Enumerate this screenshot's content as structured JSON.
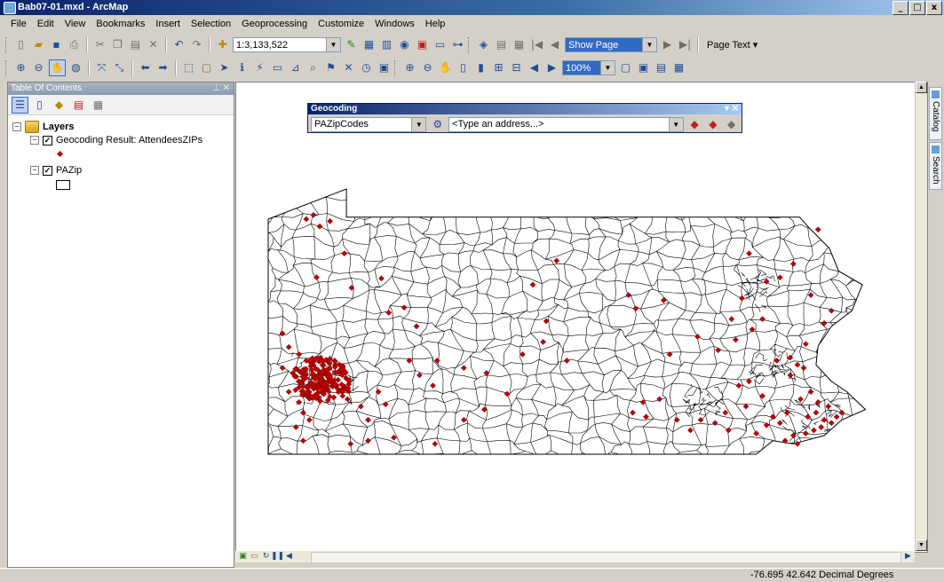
{
  "window": {
    "title": "Bab07-01.mxd - ArcMap",
    "controls": [
      "_",
      "□",
      "x"
    ]
  },
  "menu": [
    "File",
    "Edit",
    "View",
    "Bookmarks",
    "Insert",
    "Selection",
    "Geoprocessing",
    "Customize",
    "Windows",
    "Help"
  ],
  "toolbar": {
    "scale_value": "1:3,133,522",
    "page_combo": "Show Page",
    "zoom_percent": "100%",
    "page_text_label": "Page Text ▾"
  },
  "toc": {
    "header": "Table Of Contents",
    "root": "Layers",
    "layers": [
      {
        "name": "Geocoding Result: AttendeesZIPs",
        "checked": true,
        "symbol": "red-diamond"
      },
      {
        "name": "PAZip",
        "checked": true,
        "symbol": "hollow-polygon"
      }
    ]
  },
  "geocoding": {
    "title": "Geocoding",
    "locator": "PAZipCodes",
    "address_placeholder": "<Type an address...>",
    "controls": "▾ ✕"
  },
  "dock_tabs": [
    "Catalog",
    "Search"
  ],
  "status": {
    "coords": "-76.695  42.642 Decimal Degrees"
  },
  "colors": {
    "point": "#c00000",
    "title_bar": "#0a246a",
    "panel": "#d4d0c8"
  },
  "map": {
    "points": [
      [
        -80.15,
        41.98
      ],
      [
        -80.08,
        42.02
      ],
      [
        -79.92,
        41.96
      ],
      [
        -80.02,
        41.91
      ],
      [
        -79.78,
        41.65
      ],
      [
        -80.05,
        41.42
      ],
      [
        -79.71,
        41.32
      ],
      [
        -79.42,
        41.41
      ],
      [
        -79.35,
        41.08
      ],
      [
        -79.2,
        41.13
      ],
      [
        -79.08,
        40.95
      ],
      [
        -80.38,
        40.88
      ],
      [
        -80.32,
        40.75
      ],
      [
        -80.22,
        40.68
      ],
      [
        -80.15,
        40.62
      ],
      [
        -80.38,
        40.55
      ],
      [
        -80.28,
        40.5
      ],
      [
        -80.32,
        40.32
      ],
      [
        -80.22,
        40.22
      ],
      [
        -80.18,
        40.12
      ],
      [
        -80.12,
        40.05
      ],
      [
        -80.25,
        39.98
      ],
      [
        -80.18,
        39.85
      ],
      [
        -79.75,
        40.25
      ],
      [
        -79.62,
        40.18
      ],
      [
        -79.55,
        40.05
      ],
      [
        -79.45,
        40.32
      ],
      [
        -79.38,
        40.2
      ],
      [
        -79.15,
        40.62
      ],
      [
        -79.05,
        40.48
      ],
      [
        -78.92,
        40.38
      ],
      [
        -78.88,
        40.62
      ],
      [
        -78.62,
        40.55
      ],
      [
        -78.4,
        40.5
      ],
      [
        -78.2,
        40.3
      ],
      [
        -78.42,
        40.15
      ],
      [
        -78.62,
        40.05
      ],
      [
        -78.9,
        39.82
      ],
      [
        -79.3,
        39.88
      ],
      [
        -79.55,
        39.85
      ],
      [
        -79.72,
        39.82
      ],
      [
        -78.05,
        40.68
      ],
      [
        -77.85,
        40.8
      ],
      [
        -77.82,
        41.0
      ],
      [
        -77.62,
        40.62
      ],
      [
        -77.95,
        41.35
      ],
      [
        -77.72,
        41.58
      ],
      [
        -77.02,
        41.25
      ],
      [
        -76.95,
        41.12
      ],
      [
        -76.68,
        41.2
      ],
      [
        -76.62,
        40.68
      ],
      [
        -76.72,
        40.25
      ],
      [
        -76.88,
        40.22
      ],
      [
        -76.98,
        40.12
      ],
      [
        -76.85,
        40.08
      ],
      [
        -76.55,
        40.05
      ],
      [
        -76.32,
        40.05
      ],
      [
        -76.42,
        39.95
      ],
      [
        -76.18,
        40.02
      ],
      [
        -76.08,
        40.12
      ],
      [
        -75.95,
        40.38
      ],
      [
        -75.85,
        40.42
      ],
      [
        -75.88,
        40.18
      ],
      [
        -76.05,
        39.95
      ],
      [
        -75.72,
        40.28
      ],
      [
        -75.58,
        40.62
      ],
      [
        -75.45,
        40.65
      ],
      [
        -75.38,
        40.58
      ],
      [
        -75.32,
        40.55
      ],
      [
        -75.45,
        40.48
      ],
      [
        -75.25,
        40.32
      ],
      [
        -75.35,
        40.25
      ],
      [
        -75.18,
        40.22
      ],
      [
        -75.08,
        40.18
      ],
      [
        -75.2,
        40.12
      ],
      [
        -75.28,
        40.08
      ],
      [
        -75.12,
        40.05
      ],
      [
        -75.05,
        40.02
      ],
      [
        -75.0,
        40.08
      ],
      [
        -74.95,
        40.12
      ],
      [
        -75.15,
        39.98
      ],
      [
        -75.22,
        39.95
      ],
      [
        -75.3,
        39.92
      ],
      [
        -75.42,
        39.9
      ],
      [
        -75.5,
        39.85
      ],
      [
        -75.38,
        39.82
      ],
      [
        -75.55,
        40.02
      ],
      [
        -75.62,
        40.08
      ],
      [
        -75.48,
        40.12
      ],
      [
        -75.78,
        39.92
      ],
      [
        -75.68,
        40.0
      ],
      [
        -75.72,
        41.02
      ],
      [
        -75.92,
        41.22
      ],
      [
        -75.68,
        41.38
      ],
      [
        -75.55,
        41.42
      ],
      [
        -75.42,
        41.55
      ],
      [
        -75.18,
        41.88
      ],
      [
        -75.85,
        41.65
      ],
      [
        -76.15,
        40.72
      ],
      [
        -76.35,
        40.85
      ],
      [
        -76.02,
        41.02
      ],
      [
        -75.98,
        40.82
      ],
      [
        -75.82,
        40.92
      ],
      [
        -75.25,
        41.25
      ],
      [
        -75.05,
        41.1
      ],
      [
        -75.12,
        40.98
      ],
      [
        -75.3,
        40.78
      ]
    ],
    "pittsburgh_cluster_center": [
      -80.0,
      40.44
    ]
  }
}
